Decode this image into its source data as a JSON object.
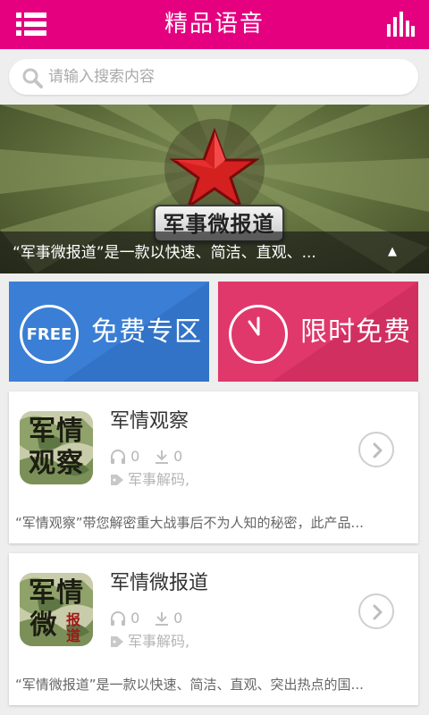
{
  "header": {
    "title": "精品语音",
    "menu_icon": "menu-icon",
    "stats_icon": "bar-chart-icon"
  },
  "search": {
    "placeholder": "请输入搜索内容",
    "value": ""
  },
  "banner": {
    "label": "军事微报道",
    "caption": "“军事微报道”是一款以快速、简洁、直观、...",
    "arrow": "▲"
  },
  "tiles": [
    {
      "icon_text": "FREE",
      "label": "免费专区",
      "color": "#3a7fd5"
    },
    {
      "label": "限时免费",
      "color": "#e0386b",
      "icon": "clock-icon"
    }
  ],
  "items": [
    {
      "title": "军情观察",
      "thumb_line1": "军情",
      "thumb_line2": "观察",
      "listens": "0",
      "downloads": "0",
      "tags": "军事解码,",
      "description": "“军情观察”带您解密重大战事后不为人知的秘密，此产品..."
    },
    {
      "title": "军情微报道",
      "thumb_line1": "军情",
      "thumb_line2": "微",
      "thumb_small": "报道",
      "listens": "0",
      "downloads": "0",
      "tags": "军事解码,",
      "description": "“军情微报道”是一款以快速、简洁、直观、突出热点的国..."
    }
  ],
  "colors": {
    "header": "#e4007f",
    "free_tile": "#3a7fd5",
    "limit_tile": "#e0386b"
  }
}
